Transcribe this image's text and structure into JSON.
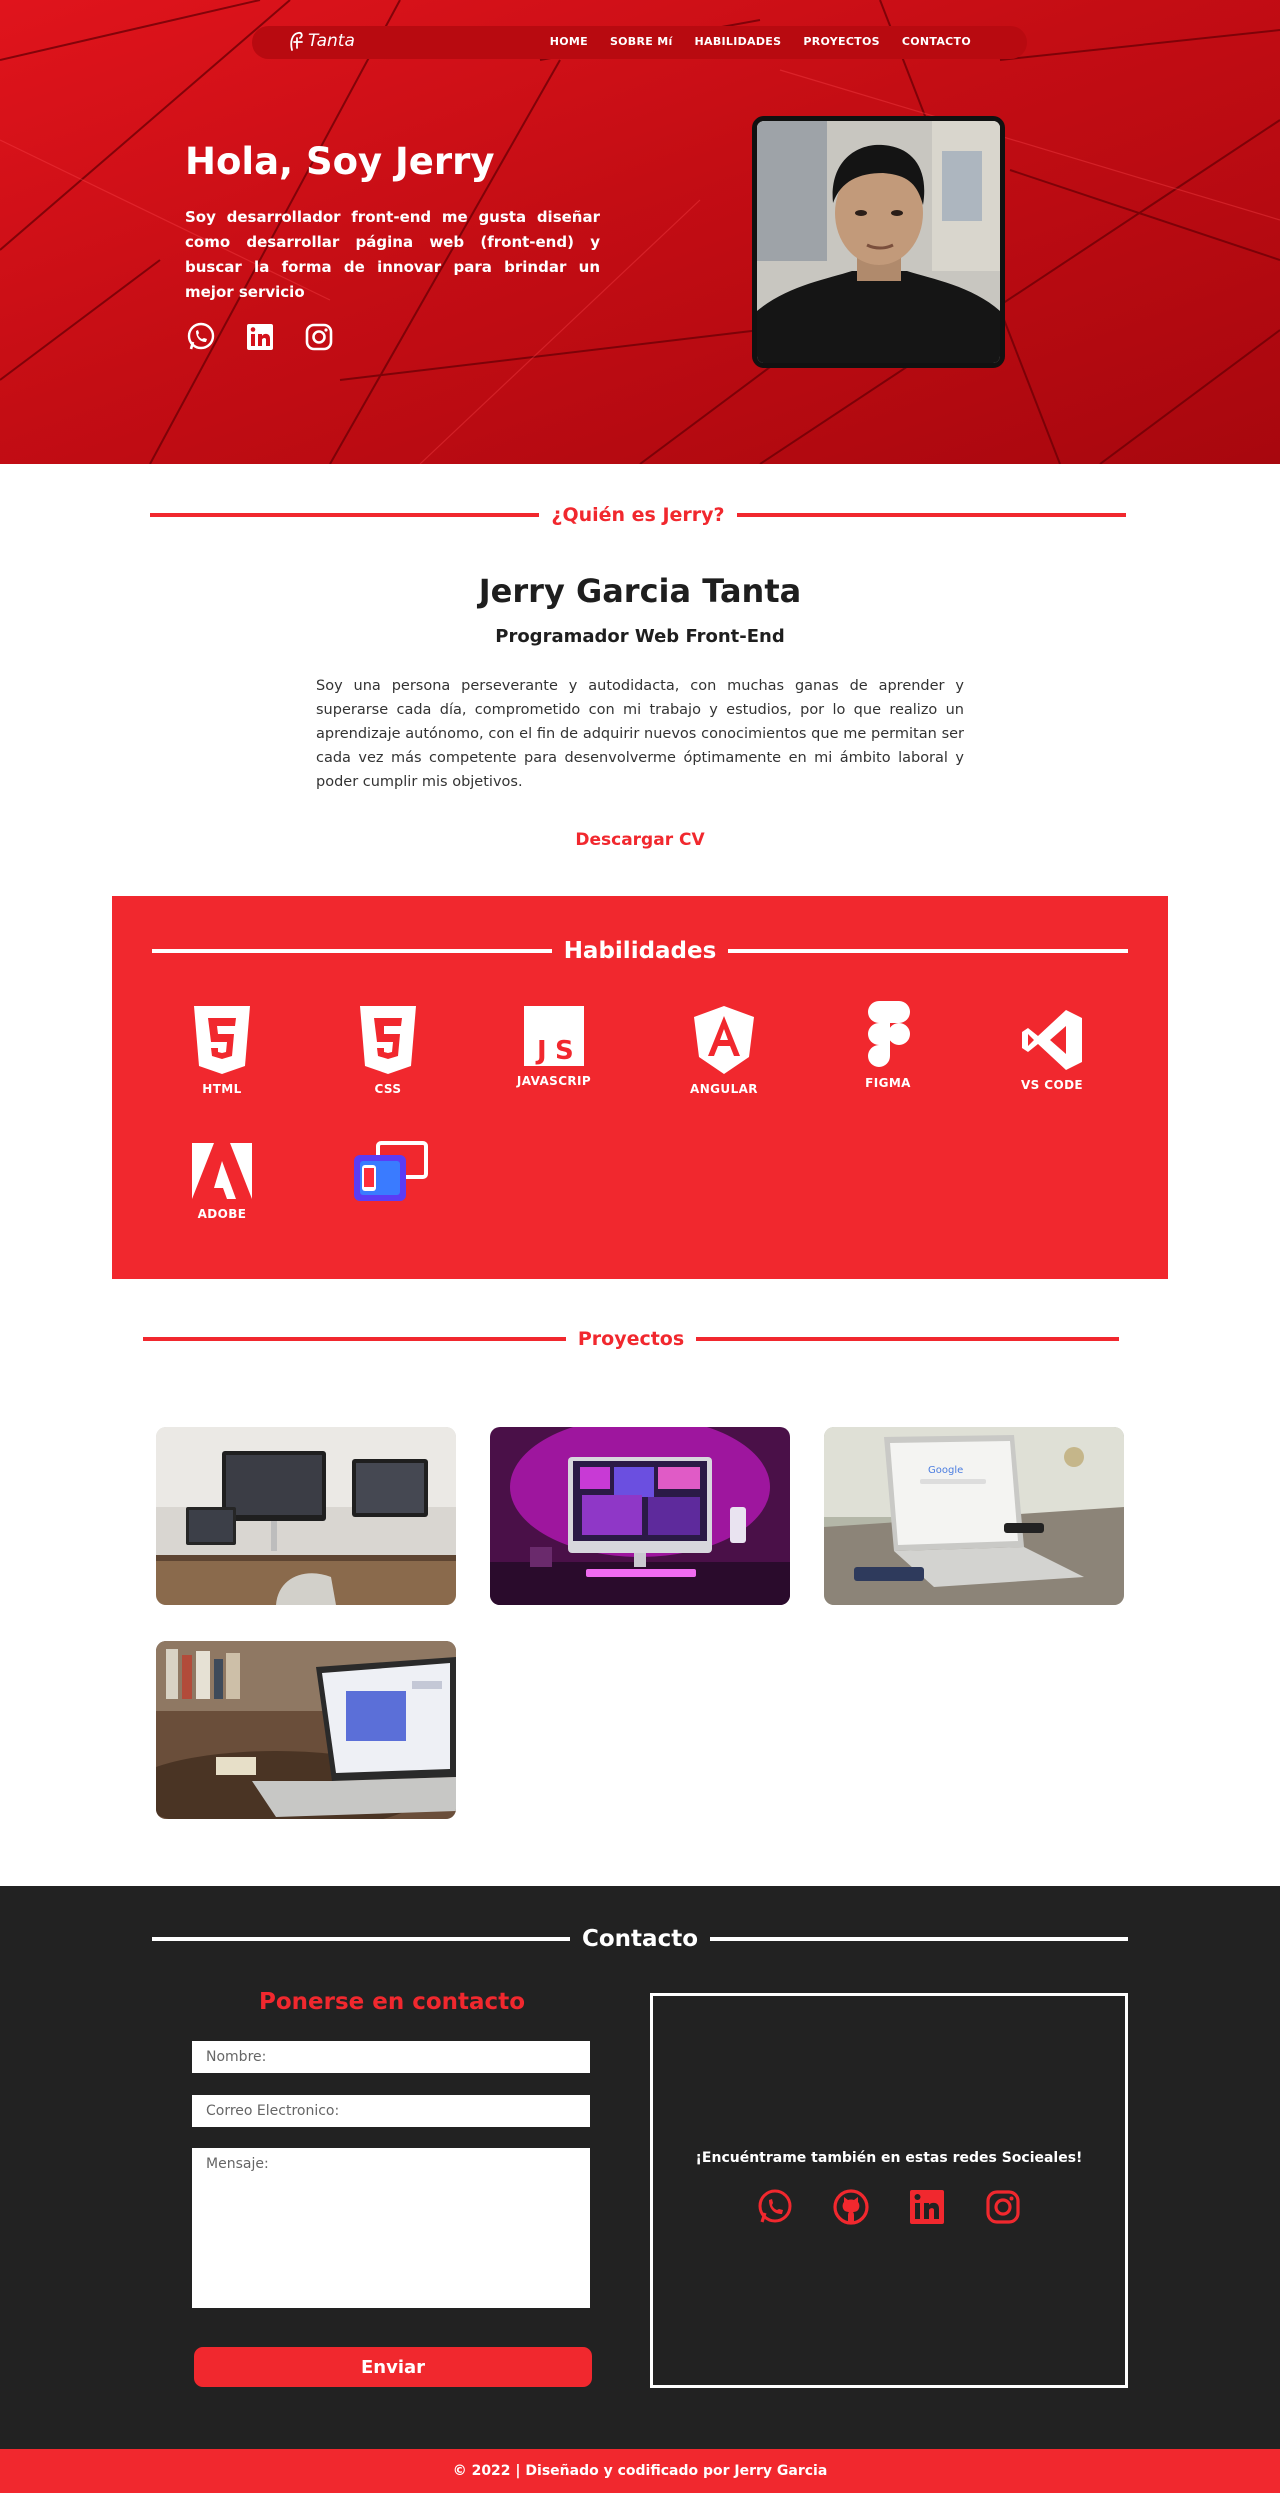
{
  "brand": {
    "logo_text": "Tanta"
  },
  "nav": {
    "items": [
      "HOME",
      "SOBRE Mí",
      "HABILIDADES",
      "PROYECTOS",
      "CONTACTO"
    ]
  },
  "hero": {
    "title": "Hola, Soy Jerry",
    "description": "Soy desarrollador front-end me gusta diseñar como desarrollar página web (front-end) y buscar la forma de innovar para brindar un mejor servicio",
    "social_icons": [
      "whatsapp-icon",
      "linkedin-icon",
      "instagram-icon"
    ]
  },
  "about": {
    "section_title": "¿Quién es Jerry?",
    "name": "Jerry Garcia Tanta",
    "role": "Programador Web Front-End",
    "text": "Soy una persona perseverante y autodidacta, con muchas ganas de aprender y superarse cada día, comprometido con mi trabajo y estudios, por lo que realizo un aprendizaje autónomo, con el fin de adquirir nuevos conocimientos que me permitan ser cada vez más competente para desenvolverme óptimamente en mi ámbito laboral y poder cumplir mis objetivos.",
    "cv_label": "Descargar CV"
  },
  "skills": {
    "section_title": "Habilidades",
    "items": [
      {
        "label": "HTML",
        "icon": "html5-icon"
      },
      {
        "label": "CSS",
        "icon": "css3-icon"
      },
      {
        "label": "JAVASCRIP",
        "icon": "javascript-icon"
      },
      {
        "label": "ANGULAR",
        "icon": "angular-icon"
      },
      {
        "label": "FIGMA",
        "icon": "figma-icon"
      },
      {
        "label": "VS CODE",
        "icon": "vscode-icon"
      },
      {
        "label": "ADOBE",
        "icon": "adobe-icon"
      },
      {
        "label": "",
        "icon": "responsive-devices-icon"
      }
    ]
  },
  "projects": {
    "section_title": "Proyectos",
    "count": 4
  },
  "contact": {
    "section_title": "Contacto",
    "form_title": "Ponerse en contacto",
    "name_placeholder": "Nombre:",
    "email_placeholder": "Correo Electronico:",
    "message_placeholder": "Mensaje:",
    "send_label": "Enviar",
    "social_title": "¡Encuéntrame también en estas redes Socieales!",
    "social_icons": [
      "whatsapp-icon",
      "github-icon",
      "linkedin-icon",
      "instagram-icon"
    ]
  },
  "footer": {
    "text": "© 2022 | Diseñado y codificado por Jerry Garcia"
  },
  "colors": {
    "accent": "#f1282e",
    "hero_red": "#d3111a",
    "dark": "#222222",
    "white": "#ffffff"
  }
}
